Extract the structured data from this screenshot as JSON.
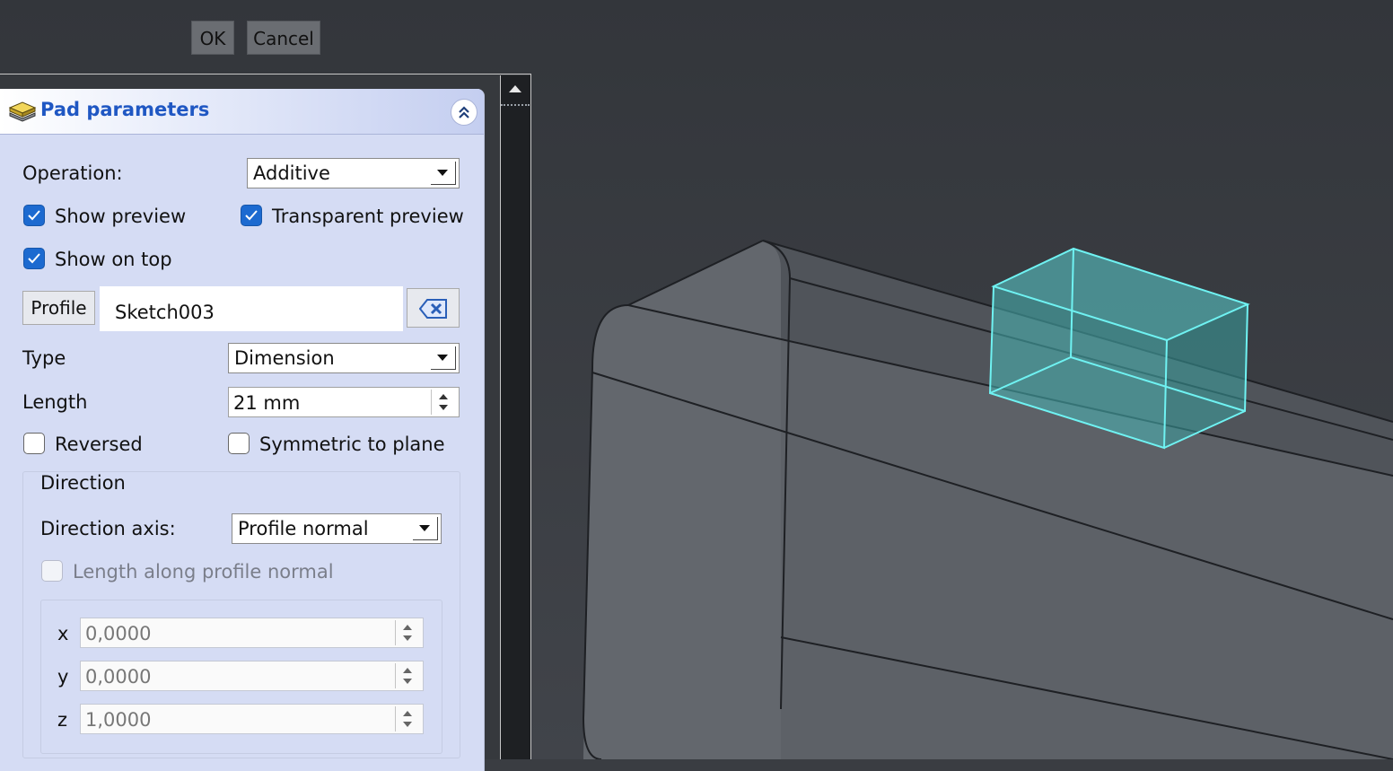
{
  "dialog": {
    "ok_label": "OK",
    "cancel_label": "Cancel"
  },
  "panel": {
    "title": "Pad parameters",
    "operation_label": "Operation:",
    "operation_value": "Additive",
    "show_preview_label": "Show preview",
    "show_preview_checked": true,
    "transparent_preview_label": "Transparent preview",
    "transparent_preview_checked": true,
    "show_on_top_label": "Show on top",
    "show_on_top_checked": true,
    "profile_button_label": "Profile",
    "profile_value": "Sketch003",
    "type_label": "Type",
    "type_value": "Dimension",
    "length_label": "Length",
    "length_value": "21 mm",
    "reversed_label": "Reversed",
    "reversed_checked": false,
    "symmetric_label": "Symmetric to plane",
    "symmetric_checked": false,
    "direction_group_label": "Direction",
    "direction_axis_label": "Direction axis:",
    "direction_axis_value": "Profile normal",
    "length_along_normal_label": "Length along profile normal",
    "length_along_normal_checked": false,
    "x_label": "x",
    "x_value": "0,0000",
    "y_label": "y",
    "y_value": "0,0000",
    "z_label": "z",
    "z_value": "1,0000"
  },
  "colors": {
    "panel_bg": "#d5dcf4",
    "title": "#1f57c3",
    "checkbox_on": "#1c6ad0",
    "preview_edge": "#6ff2f2",
    "viewport_bg": "#3a3d42"
  }
}
